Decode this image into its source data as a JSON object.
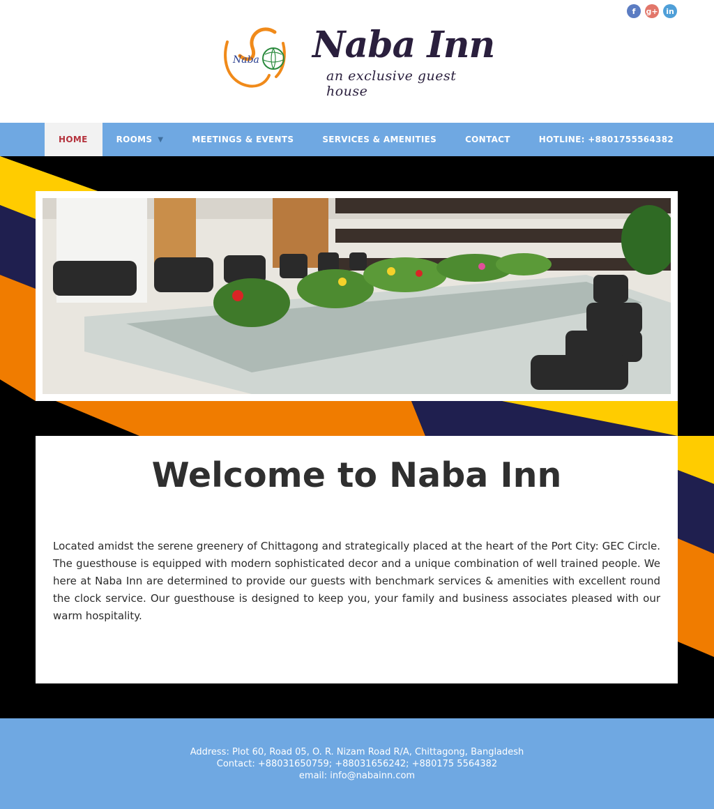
{
  "header": {
    "social": [
      {
        "name": "facebook",
        "glyph": "f",
        "color": "#5b7cc2"
      },
      {
        "name": "google-plus",
        "glyph": "g+",
        "color": "#e2766a"
      },
      {
        "name": "linkedin",
        "glyph": "in",
        "color": "#4f9fd8"
      }
    ],
    "logo": {
      "brand": "Naba Inn",
      "tagline": "an exclusive guest house",
      "mark_text": "Naba"
    }
  },
  "nav": {
    "items": [
      {
        "label": "HOME",
        "active": true
      },
      {
        "label": "ROOMS",
        "has_dropdown": true
      },
      {
        "label": "MEETINGS & EVENTS"
      },
      {
        "label": "SERVICES & AMENITIES"
      },
      {
        "label": "CONTACT"
      },
      {
        "label": "HOTLINE: +8801755564382"
      }
    ]
  },
  "main": {
    "slider_alt": "Conference room with long glass table, chairs and flower arrangements",
    "title": "Welcome to Naba Inn",
    "intro": "Located amidst the serene greenery of Chittagong and strategically placed at the heart of the Port City: GEC Circle. The guesthouse is equipped with modern sophisticated decor and a unique combination of well trained people. We here at Naba Inn are determined to provide our guests with benchmark services & amenities with excellent round the clock service. Our guesthouse is designed to keep you, your family and business associates pleased with our warm hospitality."
  },
  "footer": {
    "address": "Address: Plot 60, Road 05, O. R. Nizam Road R/A, Chittagong, Bangladesh",
    "contact": "Contact: +88031650759; +88031656242; +880175 5564382",
    "email": "email: info@nabainn.com"
  },
  "colors": {
    "nav_bg": "#6fa8e2",
    "active_text": "#b4323c",
    "stripe_yellow": "#ffcc00",
    "stripe_navy": "#1f1f4f",
    "stripe_orange": "#f07c00"
  }
}
